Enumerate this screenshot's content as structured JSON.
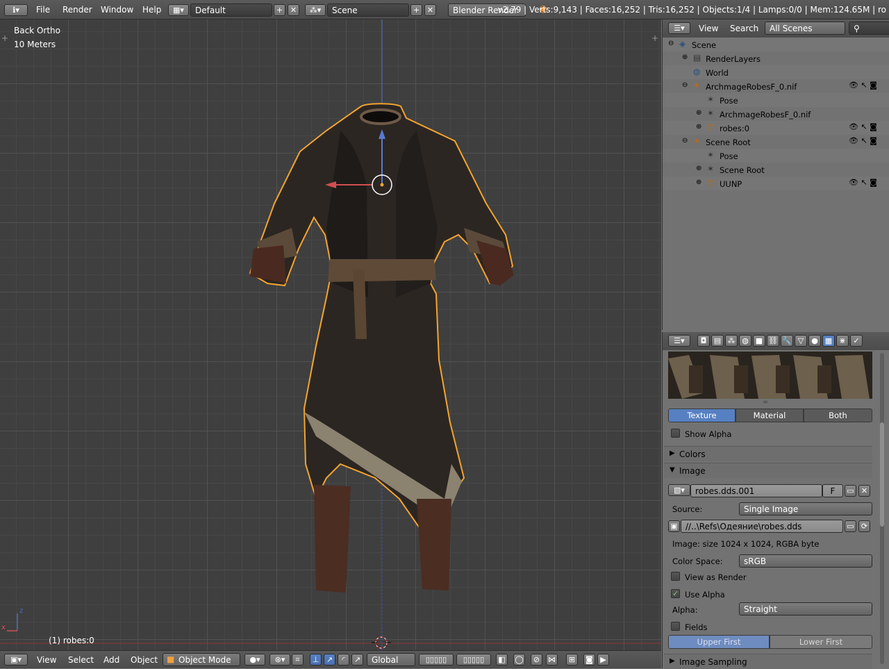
{
  "topbar": {
    "menus": [
      "File",
      "Render",
      "Window",
      "Help"
    ],
    "layout": "Default",
    "scene": "Scene",
    "engine": "Blender Render",
    "stats": "v2.79 | Verts:9,143 | Faces:16,252 | Tris:16,252 | Objects:1/4 | Lamps:0/0 | Mem:124.65M | ro"
  },
  "viewport": {
    "view_name": "Back Ortho",
    "scale": "10 Meters",
    "object_label": "(1) robes:0",
    "axis_z": "z",
    "axis_x": "x"
  },
  "bottombar": {
    "menus": [
      "View",
      "Select",
      "Add",
      "Object"
    ],
    "mode": "Object Mode",
    "orientation": "Global"
  },
  "outliner": {
    "menus": [
      "View",
      "Search"
    ],
    "filter": "All Scenes",
    "rows": [
      {
        "label": "Scene",
        "indent": 0,
        "icon": "scene-icon"
      },
      {
        "label": "RenderLayers",
        "indent": 1,
        "icon": "renderlayers-icon"
      },
      {
        "label": "World",
        "indent": 1,
        "icon": "world-icon"
      },
      {
        "label": "ArchmageRobesF_0.nif",
        "indent": 1,
        "icon": "armature-icon"
      },
      {
        "label": "Pose",
        "indent": 2,
        "icon": "pose-icon"
      },
      {
        "label": "ArchmageRobesF_0.nif",
        "indent": 2,
        "icon": "armature-data-icon"
      },
      {
        "label": "robes:0",
        "indent": 2,
        "icon": "mesh-icon"
      },
      {
        "label": "Scene Root",
        "indent": 1,
        "icon": "armature-icon"
      },
      {
        "label": "Pose",
        "indent": 2,
        "icon": "pose-icon"
      },
      {
        "label": "Scene Root",
        "indent": 2,
        "icon": "armature-data-icon"
      },
      {
        "label": "UUNP",
        "indent": 2,
        "icon": "mesh-icon"
      }
    ]
  },
  "properties": {
    "tabs": [
      "Texture",
      "Material",
      "Both"
    ],
    "show_alpha": "Show Alpha",
    "panel_colors": "Colors",
    "panel_image": "Image",
    "image_name": "robes.dds.001",
    "image_fake": "F",
    "source_label": "Source:",
    "source_value": "Single Image",
    "filepath": "//..\\Refs\\Одеяние\\robes.dds",
    "image_info": "Image: size 1024 x 1024, RGBA byte",
    "colorspace_label": "Color Space:",
    "colorspace_value": "sRGB",
    "view_as_render": "View as Render",
    "use_alpha": "Use Alpha",
    "alpha_label": "Alpha:",
    "alpha_value": "Straight",
    "fields": "Fields",
    "upper_first": "Upper First",
    "lower_first": "Lower First",
    "panel_sampling": "Image Sampling"
  },
  "colors": {
    "accent_blue": "#5680c2",
    "selection_orange": "#f3a530"
  }
}
